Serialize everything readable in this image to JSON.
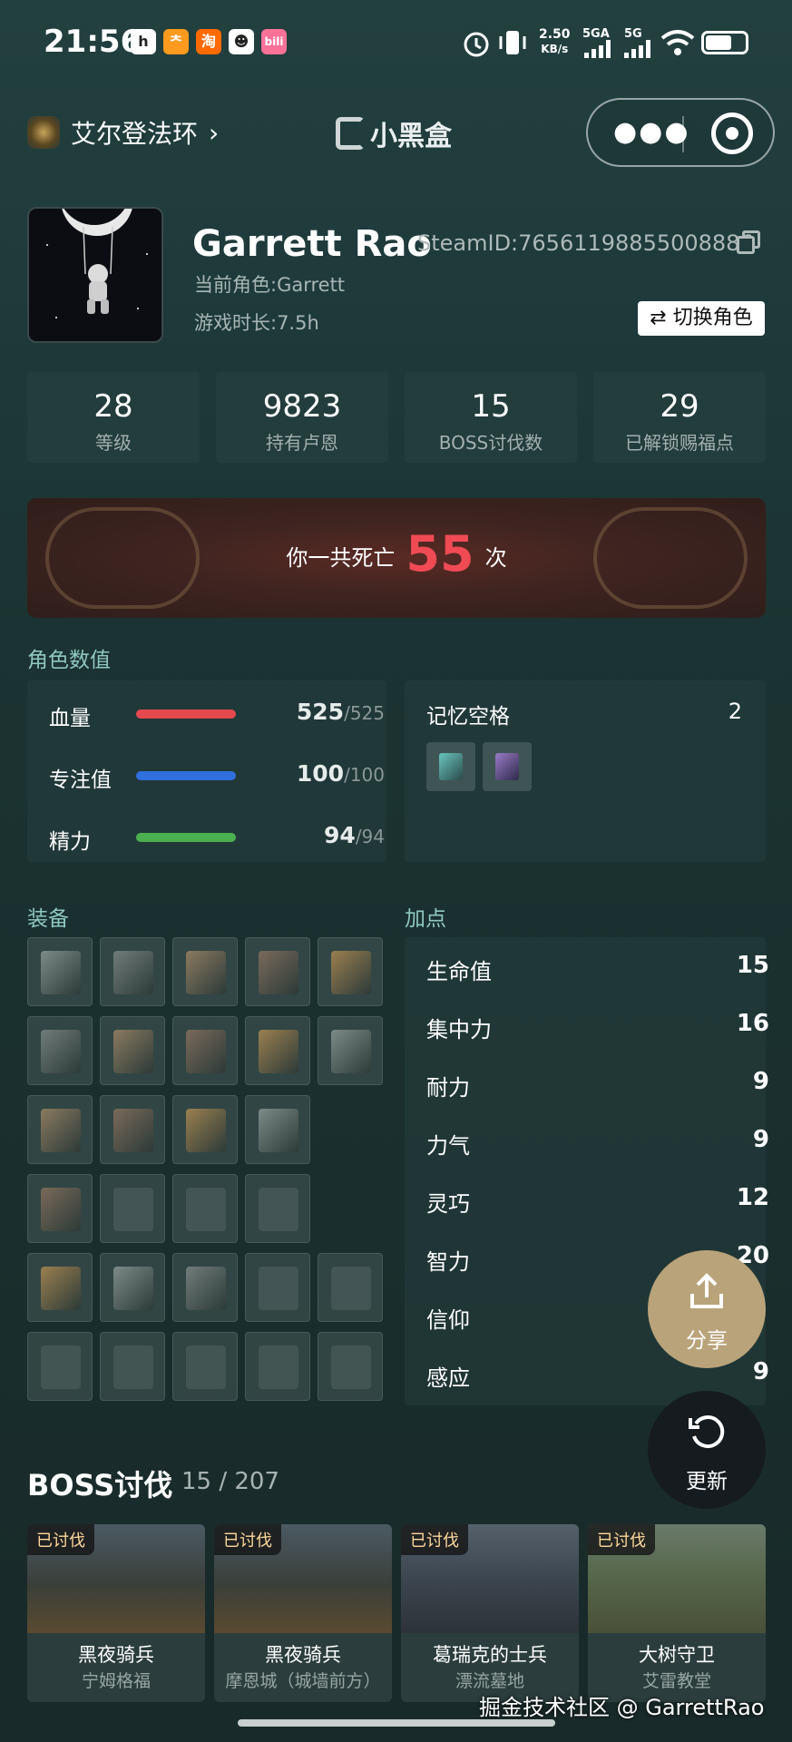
{
  "status_bar": {
    "time": "21:56",
    "net_speed": "2.50",
    "net_unit": "KB/s",
    "sig1": "5GA",
    "sig2": "5G",
    "app_icons": [
      "app-h-icon",
      "app-run-icon",
      "taobao-icon",
      "qq-icon",
      "bilibili-icon"
    ]
  },
  "header": {
    "game_title": "艾尔登法环",
    "brand": "小黑盒"
  },
  "profile": {
    "name": "Garrett Rao",
    "steam_id": "SteamID:76561198855008886",
    "current_role": "当前角色:Garrett",
    "play_time": "游戏时长:7.5h",
    "switch_role": "切换角色"
  },
  "stats": [
    {
      "value": "28",
      "label": "等级"
    },
    {
      "value": "9823",
      "label": "持有卢恩"
    },
    {
      "value": "15",
      "label": "BOSS讨伐数"
    },
    {
      "value": "29",
      "label": "已解锁赐福点"
    }
  ],
  "death": {
    "prefix": "你一共死亡",
    "count": "55",
    "suffix": "次"
  },
  "attributes": {
    "title": "角色数值",
    "bars": [
      {
        "label": "血量",
        "value": "525",
        "max": "/525",
        "color": "#e5484d",
        "fill": 1.0
      },
      {
        "label": "专注值",
        "value": "100",
        "max": "/100",
        "color": "#2f6fde",
        "fill": 1.0
      },
      {
        "label": "精力",
        "value": "94",
        "max": "/94",
        "color": "#4caf50",
        "fill": 1.0
      }
    ],
    "memory": {
      "label": "记忆空格",
      "count": "2"
    }
  },
  "equipment": {
    "title": "装备"
  },
  "points": {
    "title": "加点",
    "items": [
      {
        "name": "生命值",
        "value": "15"
      },
      {
        "name": "集中力",
        "value": "16"
      },
      {
        "name": "耐力",
        "value": "9"
      },
      {
        "name": "力气",
        "value": "9"
      },
      {
        "name": "灵巧",
        "value": "12"
      },
      {
        "name": "智力",
        "value": "20"
      },
      {
        "name": "信仰",
        "value": ""
      },
      {
        "name": "感应",
        "value": "9"
      }
    ]
  },
  "fab": {
    "share": "分享",
    "refresh": "更新"
  },
  "boss": {
    "title": "BOSS讨伐",
    "count": "15 / 207",
    "tag": "已讨伐",
    "cards": [
      {
        "name": "黑夜骑兵",
        "location": "宁姆格福"
      },
      {
        "name": "黑夜骑兵",
        "location": "摩恩城（城墙前方）"
      },
      {
        "name": "葛瑞克的士兵",
        "location": "漂流墓地"
      },
      {
        "name": "大树守卫",
        "location": "艾雷教堂"
      }
    ]
  },
  "watermark": "掘金技术社区 @ GarrettRao"
}
